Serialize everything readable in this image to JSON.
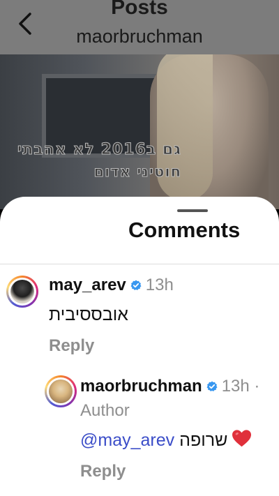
{
  "header": {
    "title": "Posts",
    "username": "maorbruchman",
    "back_icon": "chevron-left-icon"
  },
  "post": {
    "overlay_line1": "גם ב2016 לא אהבתי",
    "overlay_line2": "חוטיני אדום"
  },
  "comments_sheet": {
    "title": "Comments",
    "comments": [
      {
        "username": "may_arev",
        "verified": true,
        "time": "13h",
        "text": "אובססיבית",
        "reply_label": "Reply"
      }
    ],
    "replies": [
      {
        "username": "maorbruchman",
        "verified": true,
        "time": "13h ·",
        "author_label": "Author",
        "mention": "@may_arev",
        "text": "שרופה",
        "emoji": "heart-icon",
        "reply_label": "Reply"
      }
    ]
  },
  "colors": {
    "verified_blue": "#3897f0",
    "mention_blue": "#3b4dc8",
    "heart_red": "#e0303b"
  }
}
